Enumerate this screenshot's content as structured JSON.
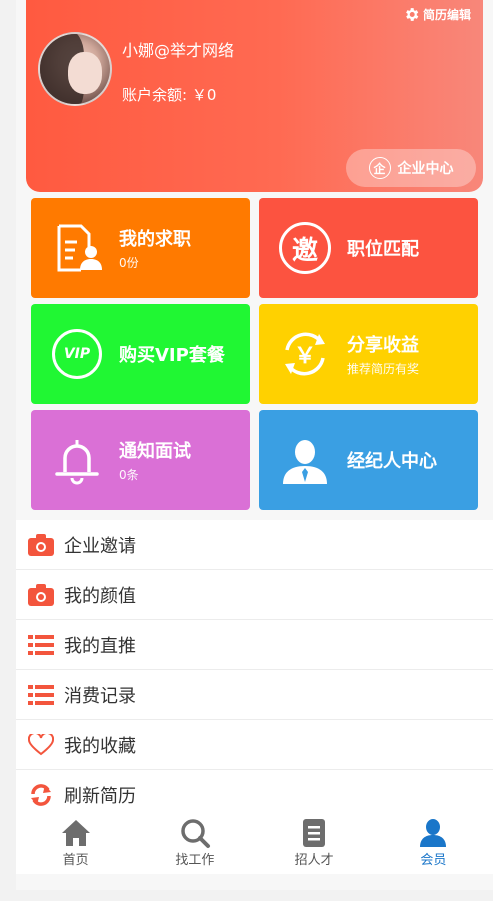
{
  "header": {
    "edit_label": "简历编辑",
    "username": "小娜@举才网络",
    "balance": "账户余额: ￥0",
    "company_center": "企业中心",
    "company_icon_char": "企"
  },
  "tiles": [
    {
      "title": "我的求职",
      "sub": "0份",
      "color": "#ff7a00",
      "icon": "resume-person-icon"
    },
    {
      "title": "职位匹配",
      "sub": "",
      "color": "#fc5340",
      "icon": "invite-seal-icon",
      "icon_char": "邀"
    },
    {
      "title": "购买VIP套餐",
      "sub": "",
      "color": "#20f733",
      "icon": "vip-icon",
      "icon_char": "VIP"
    },
    {
      "title": "分享收益",
      "sub": "推荐简历有奖",
      "color": "#ffd100",
      "icon": "yuan-refresh-icon",
      "icon_char": "￥"
    },
    {
      "title": "通知面试",
      "sub": "0条",
      "color": "#da70d6",
      "icon": "bell-icon"
    },
    {
      "title": "经纪人中心",
      "sub": "",
      "color": "#3a9fe3",
      "icon": "agent-person-icon"
    }
  ],
  "menu": [
    {
      "label": "企业邀请",
      "icon": "camera-icon"
    },
    {
      "label": "我的颜值",
      "icon": "camera-icon"
    },
    {
      "label": "我的直推",
      "icon": "list-icon"
    },
    {
      "label": "消费记录",
      "icon": "list-icon"
    },
    {
      "label": "我的收藏",
      "icon": "heart-icon"
    },
    {
      "label": "刷新简历",
      "icon": "refresh-icon"
    }
  ],
  "tabbar": [
    {
      "label": "首页",
      "icon": "home-icon",
      "active": false
    },
    {
      "label": "找工作",
      "icon": "search-icon",
      "active": false
    },
    {
      "label": "招人才",
      "icon": "document-icon",
      "active": false
    },
    {
      "label": "会员",
      "icon": "member-icon",
      "active": true
    }
  ],
  "colors": {
    "accent": "#fc5340",
    "tab_active": "#1a76c9",
    "list_icon": "#f3553d"
  }
}
